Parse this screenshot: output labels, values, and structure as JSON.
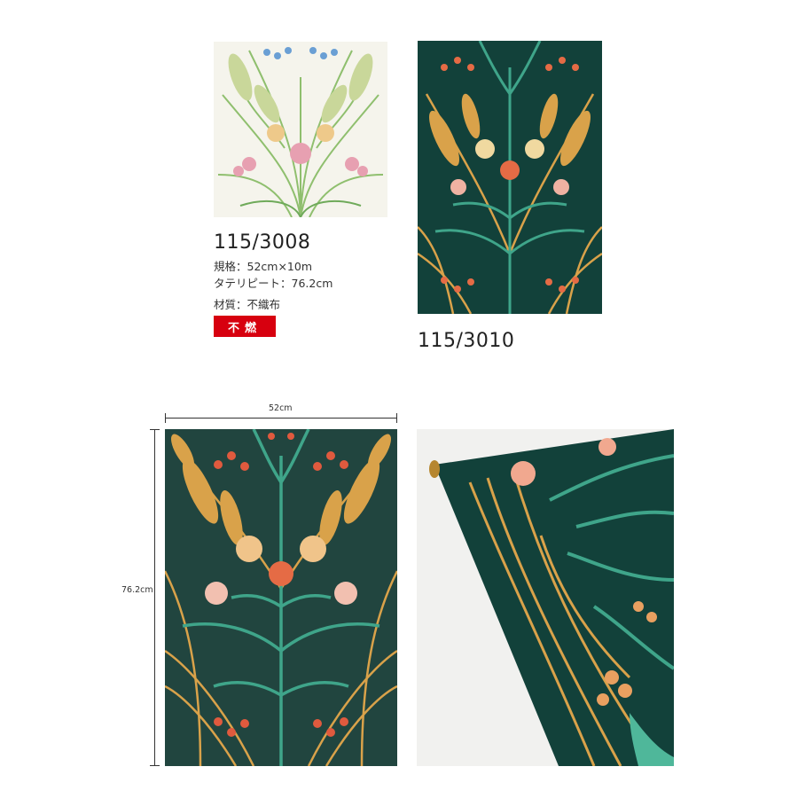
{
  "products": [
    {
      "code": "115/3008",
      "specs": {
        "size": "規格：52cm×10m",
        "repeat": "タテリピート：76.2cm",
        "material": "材質：不織布"
      },
      "badge": "不燃",
      "colors": {
        "ground": "#f4f3ea",
        "leaf": "#8dbb6a",
        "flower": "#e7a0b1",
        "accent": "#6a9fd4"
      }
    },
    {
      "code": "115/3010",
      "colors": {
        "ground": "#12413a",
        "leaf": "#3fa58a",
        "wheat": "#d9a24a",
        "flower": "#e56b45"
      }
    }
  ],
  "dimensions": {
    "width_label": "52cm",
    "height_label": "76.2cm"
  },
  "colors": {
    "badge": "#d7000f"
  }
}
